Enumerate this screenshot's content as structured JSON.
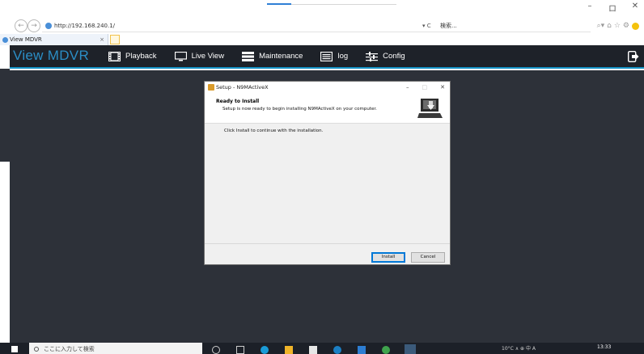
{
  "browser": {
    "url": "http://192.168.240.1/",
    "search_placeholder": "検索...",
    "refresh_label": "▾ C",
    "tab_title": "View MDVR",
    "tab_close": "×",
    "window_controls": {
      "minimize": "–",
      "maximize": "ロ",
      "close": "✕"
    }
  },
  "app": {
    "brand": "View MDVR",
    "nav": [
      {
        "label": "Playback",
        "icon": "film-icon"
      },
      {
        "label": "Live View",
        "icon": "monitor-icon"
      },
      {
        "label": "Maintenance",
        "icon": "server-icon"
      },
      {
        "label": "log",
        "icon": "list-icon"
      },
      {
        "label": "Config",
        "icon": "sliders-icon"
      }
    ],
    "logout_icon": "logout-icon"
  },
  "dialog": {
    "title": "Setup - N9MActiveX",
    "controls": {
      "minimize": "–",
      "maximize": "□",
      "close": "✕"
    },
    "heading": "Ready to Install",
    "subheading": "Setup is now ready to begin installing N9MActiveX on your computer.",
    "body": "Click Install to continue with the installation.",
    "install_label": "Install",
    "cancel_label": "Cancel"
  },
  "taskbar": {
    "search_text": "ここに入力して検索",
    "tray_text": "10°C ∧ ⊕ 中 A",
    "clock": "13:33"
  },
  "colors": {
    "app_header_bg": "#1e2229",
    "accent": "#1593c6",
    "brand": "#2b8ec6",
    "content_bg": "#2d3139"
  }
}
